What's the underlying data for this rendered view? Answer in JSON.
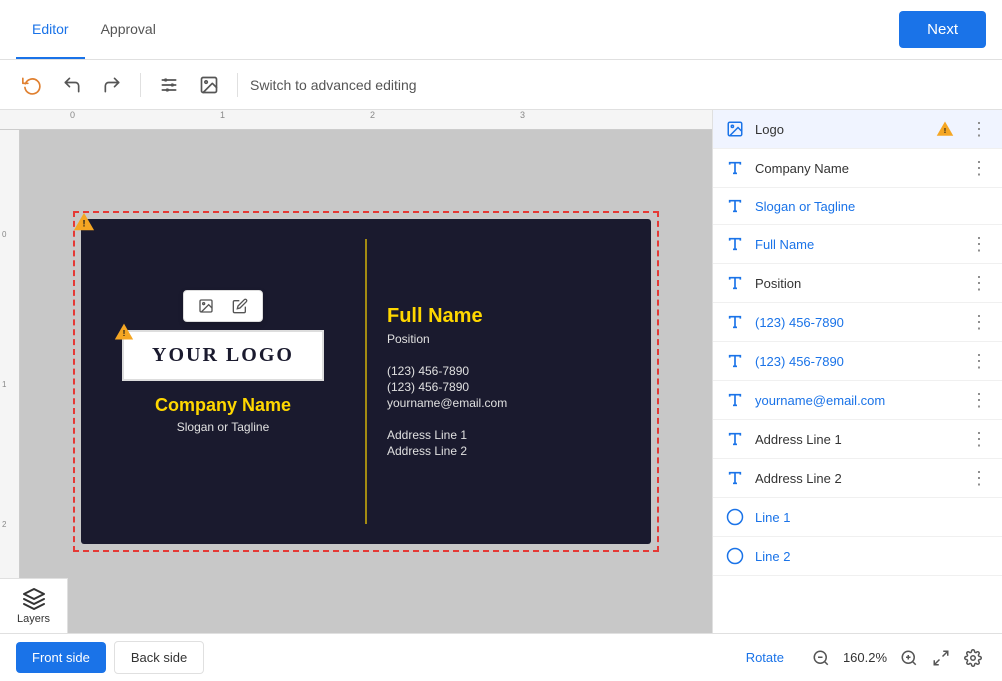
{
  "header": {
    "tab_editor": "Editor",
    "tab_approval": "Approval",
    "next_label": "Next"
  },
  "toolbar": {
    "advanced_editing_label": "Switch to advanced editing"
  },
  "card": {
    "logo_text": "YOUR LOGO",
    "company_name": "Company Name",
    "slogan": "Slogan or Tagline",
    "full_name": "Full Name",
    "position": "Position",
    "phone1": "(123) 456-7890",
    "phone2": "(123) 456-7890",
    "email": "yourname@email.com",
    "address1": "Address Line 1",
    "address2": "Address Line 2"
  },
  "layers": [
    {
      "type": "image",
      "label": "Logo",
      "warning": true,
      "more": true,
      "active": true
    },
    {
      "type": "text",
      "label": "Company Name",
      "color": "normal",
      "more": true
    },
    {
      "type": "text",
      "label": "Slogan or Tagline",
      "color": "blue",
      "more": false
    },
    {
      "type": "text",
      "label": "Full Name",
      "color": "blue",
      "more": true
    },
    {
      "type": "text",
      "label": "Position",
      "color": "normal",
      "more": true
    },
    {
      "type": "text",
      "label": "(123) 456-7890",
      "color": "blue",
      "more": true
    },
    {
      "type": "text",
      "label": "(123) 456-7890",
      "color": "blue",
      "more": true
    },
    {
      "type": "text",
      "label": "yourname@email.com",
      "color": "blue",
      "more": true
    },
    {
      "type": "text",
      "label": "Address Line 1",
      "color": "normal",
      "more": true
    },
    {
      "type": "text",
      "label": "Address Line 2",
      "color": "normal",
      "more": true
    },
    {
      "type": "shape",
      "label": "Line 1",
      "color": "blue",
      "more": false
    },
    {
      "type": "shape",
      "label": "Line 2",
      "color": "blue",
      "more": false
    }
  ],
  "bottom": {
    "front_side": "Front side",
    "back_side": "Back side",
    "rotate": "Rotate",
    "zoom_level": "160.2%",
    "layers_label": "Layers"
  }
}
